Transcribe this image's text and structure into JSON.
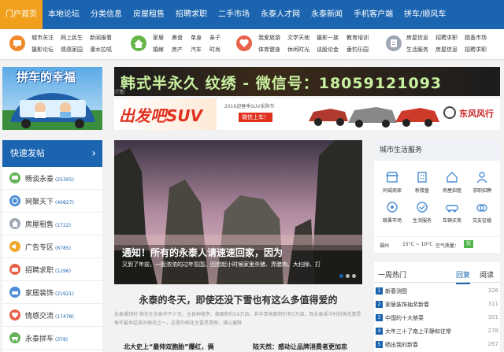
{
  "nav": {
    "items": [
      {
        "label": "门户首页",
        "active": true
      },
      {
        "label": "本地论坛"
      },
      {
        "label": "分类信息"
      },
      {
        "label": "房屋租售"
      },
      {
        "label": "招聘求职"
      },
      {
        "label": "二手市场"
      },
      {
        "label": "永泰人才网"
      },
      {
        "label": "永泰新闻"
      },
      {
        "label": "手机客户端"
      },
      {
        "label": "拼车/顺风车"
      }
    ]
  },
  "sublinks": {
    "groups": [
      {
        "icon": "forum-icon",
        "color": "#f08a2c",
        "row1": [
          "城市关注",
          "网上民生",
          "新闻报看"
        ],
        "row2": [
          "摄影论坛",
          "情感家园",
          "灌水拉呱"
        ]
      },
      {
        "icon": "home-icon",
        "color": "#68b64a",
        "row1": [
          "家居",
          "美食",
          "单身",
          "亲子"
        ],
        "row2": [
          "婚嫁",
          "房产",
          "汽车",
          "时尚"
        ]
      },
      {
        "icon": "heart-icon",
        "color": "#e8624b",
        "row1": [
          "我爱旅游",
          "文学天地",
          "摄影一族",
          "教育培训"
        ],
        "row2": [
          "体育健身",
          "休闲时光",
          "谈股论金",
          "垂钓乐园"
        ]
      },
      {
        "icon": "info-icon",
        "color": "#9ea7b3",
        "row1": [
          "房屋信息",
          "招聘求职",
          "跳蚤市场"
        ],
        "row2": [
          "生活服务",
          "房屋信息",
          "招聘求职"
        ]
      }
    ]
  },
  "ads": {
    "left_title": "拼车的幸福",
    "banner_top": "韩式半永久  纹绣 - 微信号：18059121093",
    "banner_top_tag": "广告",
    "banner_bottom_slogan": "出发吧SUV",
    "banner_bottom_sub": "2016迎春季SUV采购节",
    "banner_bottom_btn": "微信上车！",
    "banner_bottom_brand": "东风风行"
  },
  "sidebar": {
    "title": "快速发帖",
    "items": [
      {
        "label": "畅谈永泰",
        "count": "(25305)",
        "icon": "chat-icon",
        "color": "#66b25a"
      },
      {
        "label": "网聚天下",
        "count": "(40827)",
        "icon": "globe-icon",
        "color": "#4c8fd6"
      },
      {
        "label": "房屋租售",
        "count": "(1722)",
        "icon": "house-icon",
        "color": "#9ea7b3"
      },
      {
        "label": "广告专区",
        "count": "(6785)",
        "icon": "megaphone-icon",
        "color": "#f0a92c"
      },
      {
        "label": "招聘求职",
        "count": "(1296)",
        "icon": "briefcase-icon",
        "color": "#e8624b"
      },
      {
        "label": "家居装饰",
        "count": "(21921)",
        "icon": "sofa-icon",
        "color": "#4c8fd6"
      },
      {
        "label": "情感交流",
        "count": "(17478)",
        "icon": "heart-icon",
        "color": "#e8624b"
      },
      {
        "label": "永泰拼车",
        "count": "(378)",
        "icon": "car-icon",
        "color": "#66b25a"
      }
    ]
  },
  "hero": {
    "title": "通知！所有的永泰人请速速回家，因为",
    "subtitle": "又到了年前，一股浓浓的过年氛围，回想起小时候家里杀猪、弄腊肉、大扫除、打"
  },
  "headline": {
    "title": "永泰的冬天，即使还没下雪也有这么多值得爱的",
    "summary": "永泰溪拜村 梅花在永泰并不少见，全县种植李、梅面积约16万亩，其中青梅面积约有5万亩。而永泰溪洋村的梅花算是每年最早绽放的梅花之一，这里的梅花主要是青梅，满山遍野"
  },
  "news_row": {
    "left": "北大史上“最帅双胞胎”爆红，俩",
    "right": "陆天然：感动让品牌消费者更加忠"
  },
  "services": {
    "title": "城市生活服务",
    "row1": [
      {
        "label": "同城商家",
        "icon": "shop-icon"
      },
      {
        "label": "新楼盘",
        "icon": "building-icon"
      },
      {
        "label": "房屋招租",
        "icon": "house-icon"
      },
      {
        "label": "求职招聘",
        "icon": "person-icon"
      }
    ],
    "row2": [
      {
        "label": "跳蚤市场",
        "icon": "tag-icon"
      },
      {
        "label": "生活服务",
        "icon": "service-icon"
      },
      {
        "label": "车辆买卖",
        "icon": "car-icon"
      },
      {
        "label": "交友征婚",
        "icon": "ring-icon"
      }
    ]
  },
  "weather": {
    "city": "福州",
    "temp": "15°C ~ 10°C",
    "aq_label": "空气质量：",
    "aq_value": "优"
  },
  "hot": {
    "title": "一周热门",
    "tab_reply": "回复",
    "tab_read": "阅读",
    "items": [
      {
        "rank": "1",
        "title": "新春测图",
        "count": "326"
      },
      {
        "rank": "2",
        "title": "家居装饰抽奖新春",
        "count": "311"
      },
      {
        "rank": "3",
        "title": "中国的十大禁菜",
        "count": "301"
      },
      {
        "rank": "4",
        "title": "大年三十了南上平静和往常",
        "count": "278"
      },
      {
        "rank": "5",
        "title": "晒出我的新春",
        "count": "267"
      }
    ]
  },
  "colors": {
    "primary": "#1a64b0",
    "accent": "#f0a01c"
  }
}
